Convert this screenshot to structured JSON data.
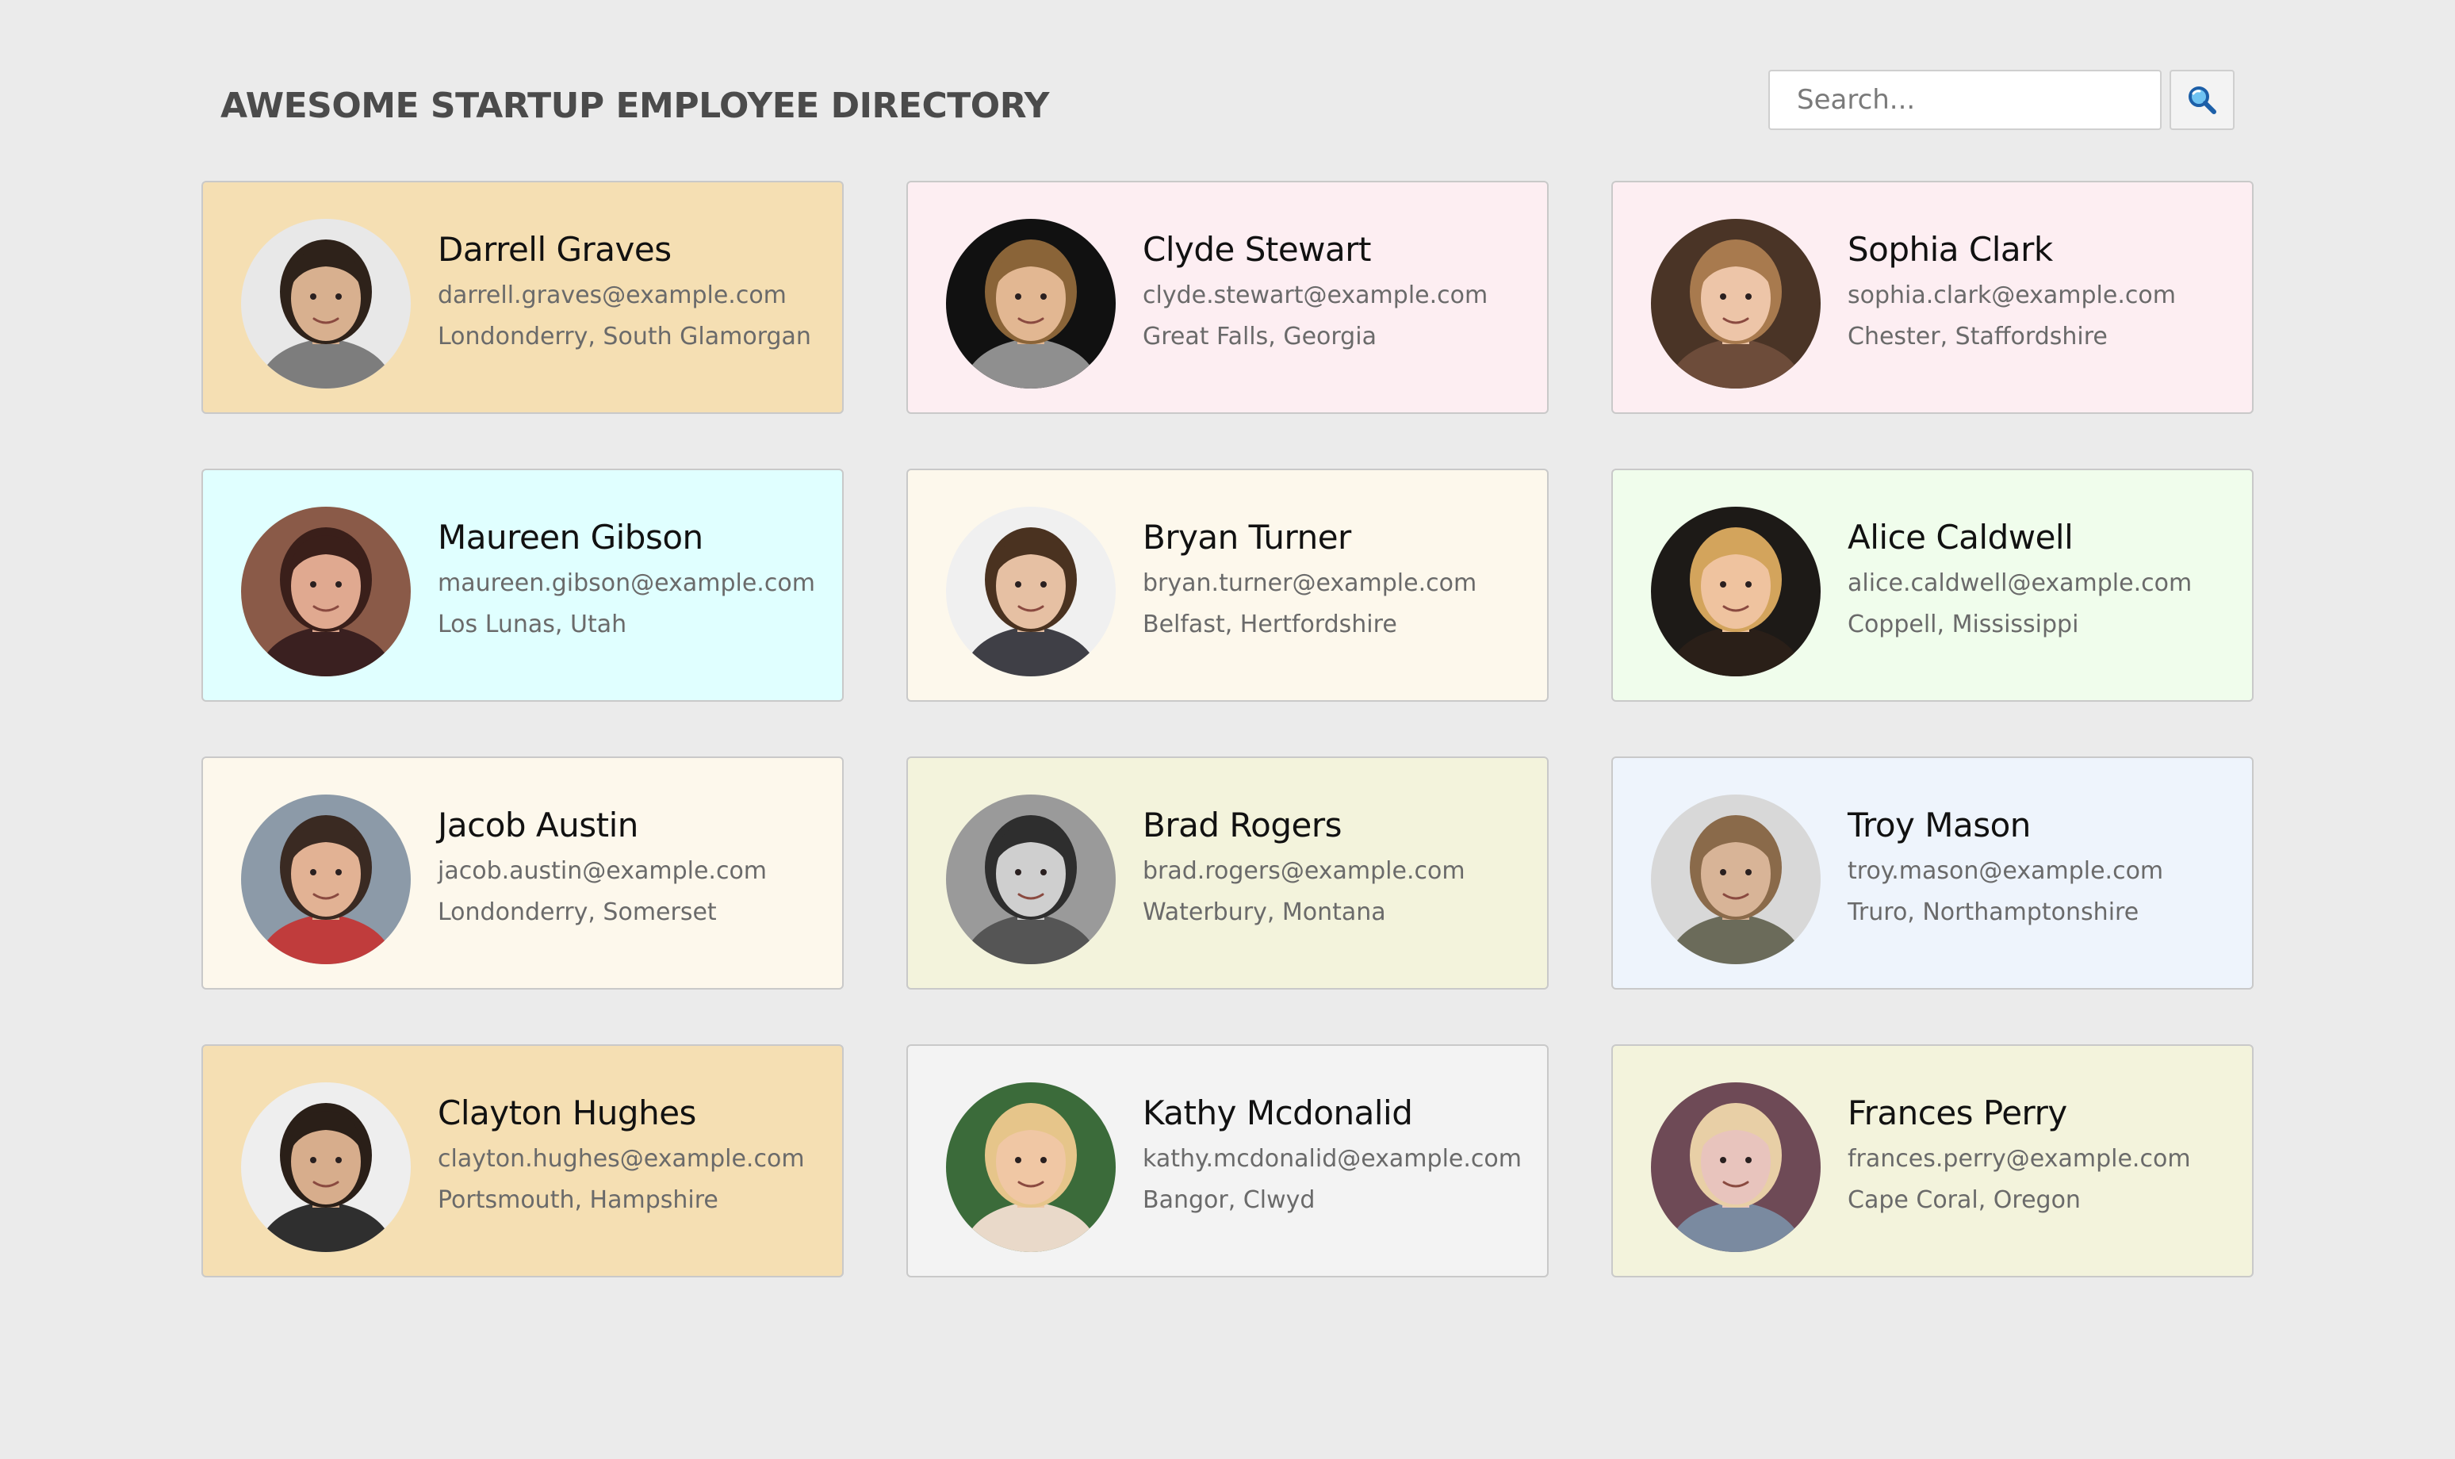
{
  "header": {
    "title": "AWESOME STARTUP EMPLOYEE DIRECTORY",
    "search_placeholder": "Search...",
    "search_icon": "magnifier-icon"
  },
  "employees": [
    {
      "name": "Darrell Graves",
      "email": "darrell.graves@example.com",
      "location": "Londonderry, South Glamorgan",
      "card_color": "#f5dfb3",
      "skin": "#d8b08f",
      "hair": "#2e221a",
      "shirt": "#7d7d7d",
      "bg": "#e8e8e8"
    },
    {
      "name": "Clyde Stewart",
      "email": "clyde.stewart@example.com",
      "location": "Great Falls, Georgia",
      "card_color": "#fdeef2",
      "skin": "#e2b792",
      "hair": "#8a6438",
      "shirt": "#8f8f8f",
      "bg": "#111111"
    },
    {
      "name": "Sophia Clark",
      "email": "sophia.clark@example.com",
      "location": "Chester, Staffordshire",
      "card_color": "#fdeef2",
      "skin": "#edc5a8",
      "hair": "#a87a4e",
      "shirt": "#6d4c3a",
      "bg": "#4a3426"
    },
    {
      "name": "Maureen Gibson",
      "email": "maureen.gibson@example.com",
      "location": "Los Lunas, Utah",
      "card_color": "#e0ffff",
      "skin": "#e0a990",
      "hair": "#3a1f1a",
      "shirt": "#3a2020",
      "bg": "#8a5a48"
    },
    {
      "name": "Bryan Turner",
      "email": "bryan.turner@example.com",
      "location": "Belfast, Hertfordshire",
      "card_color": "#fdf8ec",
      "skin": "#e6c0a3",
      "hair": "#4a3220",
      "shirt": "#3f3f46",
      "bg": "#f0f0f0"
    },
    {
      "name": "Alice Caldwell",
      "email": "alice.caldwell@example.com",
      "location": "Coppell, Mississippi",
      "card_color": "#f0fdec",
      "skin": "#efc39f",
      "hair": "#d3a45c",
      "shirt": "#2a1f18",
      "bg": "#1d1a17"
    },
    {
      "name": "Jacob Austin",
      "email": "jacob.austin@example.com",
      "location": "Londonderry, Somerset",
      "card_color": "#fdf8ec",
      "skin": "#e2b294",
      "hair": "#3a2a22",
      "shirt": "#c03c3c",
      "bg": "#8c9aa8"
    },
    {
      "name": "Brad Rogers",
      "email": "brad.rogers@example.com",
      "location": "Waterbury, Montana",
      "card_color": "#f3f3dc",
      "skin": "#cfcfcf",
      "hair": "#2e2e2e",
      "shirt": "#555555",
      "bg": "#9a9a9a"
    },
    {
      "name": "Troy Mason",
      "email": "troy.mason@example.com",
      "location": "Truro, Northamptonshire",
      "card_color": "#eef4fc",
      "skin": "#d8b497",
      "hair": "#8a6a4a",
      "shirt": "#6b6b5a",
      "bg": "#d8d8d8"
    },
    {
      "name": "Clayton Hughes",
      "email": "clayton.hughes@example.com",
      "location": "Portsmouth, Hampshire",
      "card_color": "#f5dfb3",
      "skin": "#d7ad8c",
      "hair": "#2a1f18",
      "shirt": "#2f2f2f",
      "bg": "#eeeeee"
    },
    {
      "name": "Kathy Mcdonalid",
      "email": "kathy.mcdonalid@example.com",
      "location": "Bangor, Clwyd",
      "card_color": "#f3f3f3",
      "skin": "#f0c7a4",
      "hair": "#e6c58a",
      "shirt": "#e9d9c9",
      "bg": "#3b6b3a"
    },
    {
      "name": "Frances Perry",
      "email": "frances.perry@example.com",
      "location": "Cape Coral, Oregon",
      "card_color": "#f3f3dc",
      "skin": "#e8c4bd",
      "hair": "#e8cfa6",
      "shirt": "#7a8aa0",
      "bg": "#6e4a56"
    }
  ]
}
